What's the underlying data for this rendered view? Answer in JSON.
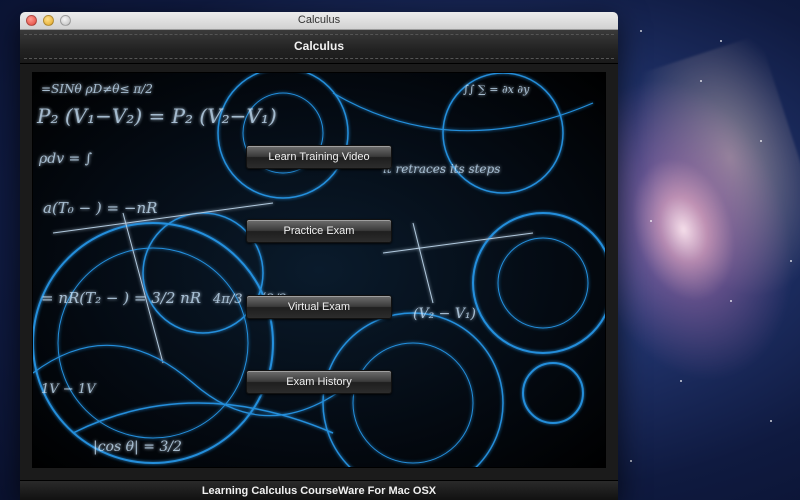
{
  "window": {
    "title": "Calculus"
  },
  "header": {
    "title": "Calculus"
  },
  "menu": {
    "buttons": [
      {
        "label": "Learn Training Video"
      },
      {
        "label": "Practice Exam"
      },
      {
        "label": "Virtual Exam"
      },
      {
        "label": "Exam History"
      }
    ]
  },
  "footer": {
    "text": "Learning Calculus CourseWare For Mac OSX"
  },
  "colors": {
    "glow": "#29a8ff",
    "header_bg": "#222222",
    "titlebar_bg": "#dcdcdc"
  },
  "icons": {
    "close": "close-icon",
    "minimize": "minimize-icon",
    "zoom": "zoom-icon"
  }
}
